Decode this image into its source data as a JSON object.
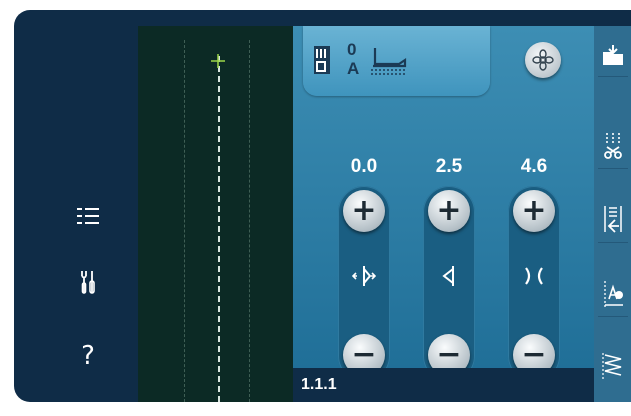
{
  "stitch_settings": {
    "columns": [
      {
        "value": "0.0",
        "plus": "+",
        "minus": "−",
        "icon": "stitch-position-icon"
      },
      {
        "value": "2.5",
        "plus": "+",
        "minus": "−",
        "icon": "stitch-width-icon"
      },
      {
        "value": "4.6",
        "plus": "+",
        "minus": "−",
        "icon": "stitch-length-icon"
      }
    ]
  },
  "header": {
    "presser_foot_code": "0",
    "presser_foot_letter": "A"
  },
  "footer": {
    "stitch_number": "1.1.1"
  },
  "left_menu": {
    "help_label": "?"
  },
  "colors": {
    "background": "#0f2c47",
    "panel": "#2e82ad",
    "preview": "#0c2a25"
  }
}
